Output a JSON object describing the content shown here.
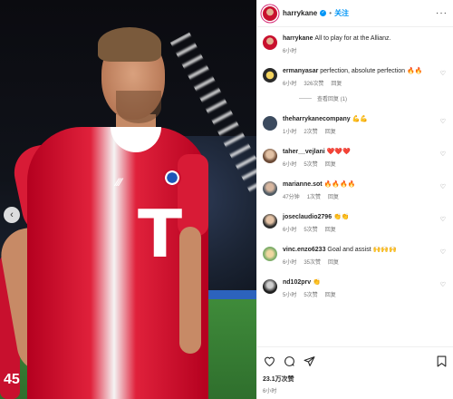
{
  "post": {
    "username": "harrykane",
    "follow_label": "关注",
    "more_label": "···",
    "caption": "All to play for at the Allianz.",
    "caption_time": "6小时",
    "likes": "23.1万次赞",
    "posted": "6小时",
    "image_text": {
      "sponsor_logo": "T",
      "sleeve_number": "45"
    }
  },
  "comments": [
    {
      "user": "ermanyasar",
      "text": "perfection, absolute perfection 🔥🔥",
      "time": "6小时",
      "likes": "326次赞",
      "reply": "回复",
      "view_replies": "查看回复 (1)"
    },
    {
      "user": "theharrykanecompany",
      "text": "💪💪",
      "time": "1小时",
      "likes": "2次赞",
      "reply": "回复"
    },
    {
      "user": "taher__vejlani",
      "text": "❤️❤️❤️",
      "time": "6小时",
      "likes": "5次赞",
      "reply": "回复"
    },
    {
      "user": "marianne.sot",
      "text": "🔥🔥🔥🔥",
      "time": "47分钟",
      "likes": "1次赞",
      "reply": "回复"
    },
    {
      "user": "joseclaudio2796",
      "text": "👏👏",
      "time": "6小时",
      "likes": "5次赞",
      "reply": "回复"
    },
    {
      "user": "vinc.enzo6233",
      "text": "Goal and assist 🙌🙌🙌",
      "time": "6小时",
      "likes": "35次赞",
      "reply": "回复"
    },
    {
      "user": "nd102prv",
      "text": "👏",
      "time": "5小时",
      "likes": "5次赞",
      "reply": "回复"
    }
  ],
  "colors": {
    "accent": "#0095f6",
    "text": "#262626",
    "muted": "#737373",
    "jersey_red": "#d81b36"
  },
  "icons": [
    "heart-icon",
    "comment-icon",
    "share-icon",
    "bookmark-icon",
    "more-icon",
    "verified-icon"
  ]
}
